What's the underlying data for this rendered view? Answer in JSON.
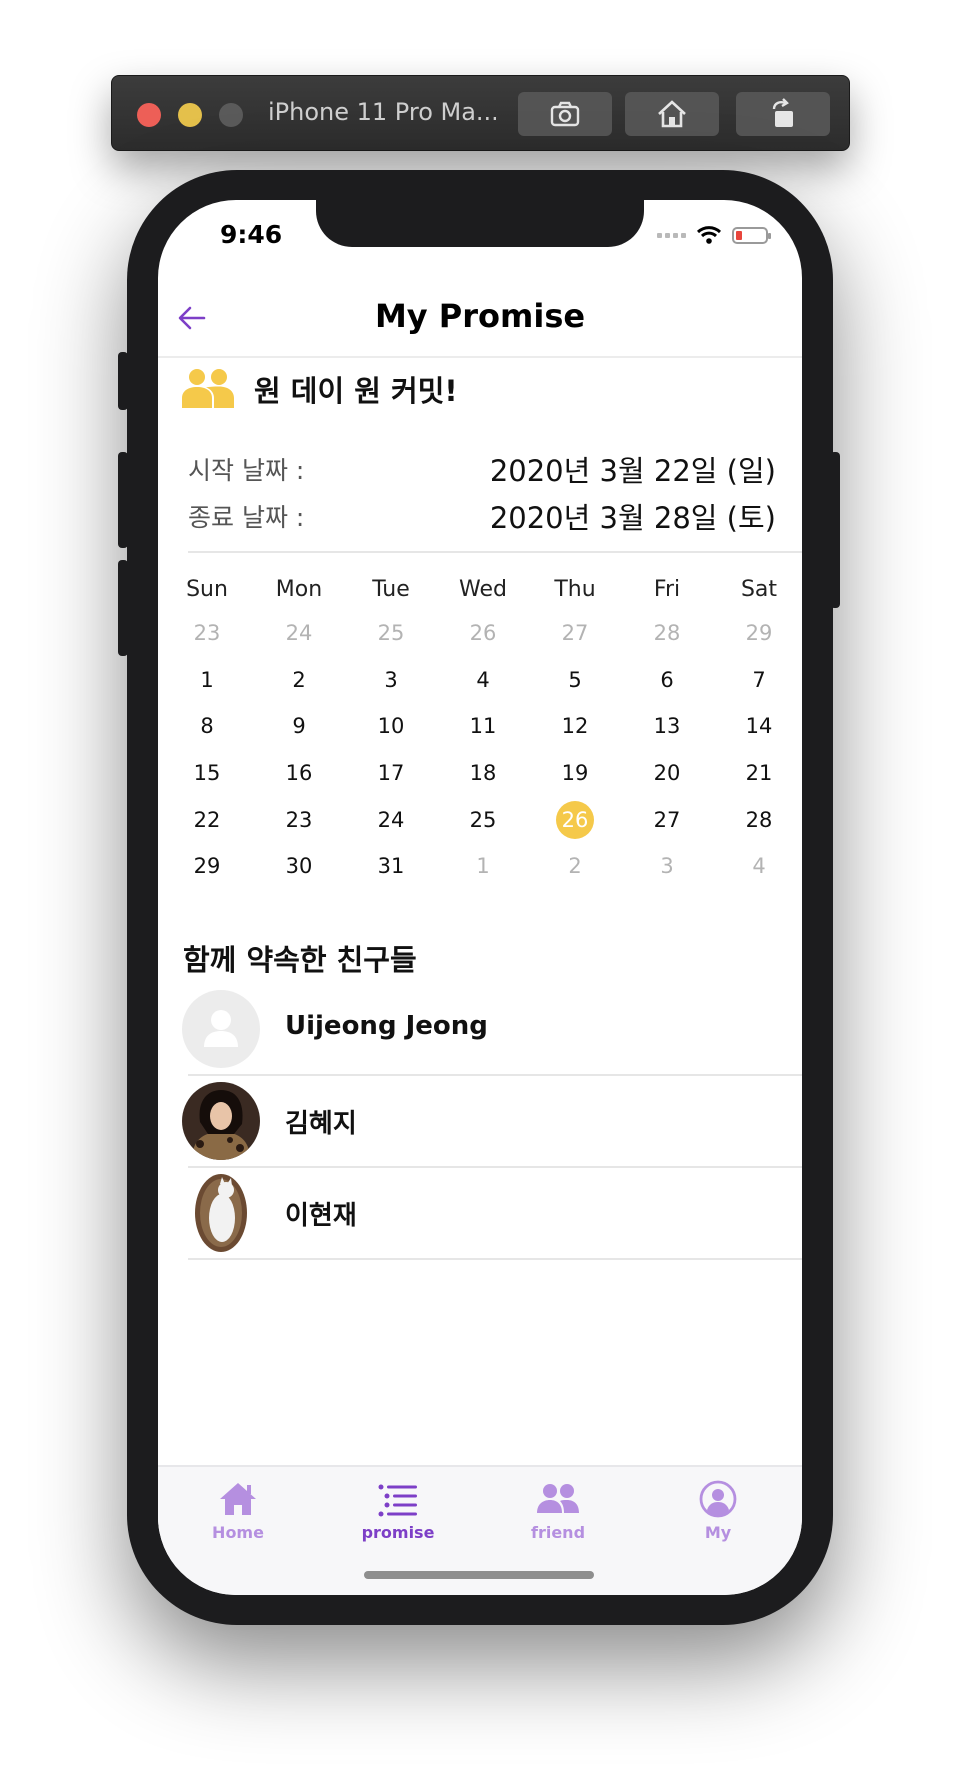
{
  "simulator": {
    "title": "iPhone 11 Pro Ma..."
  },
  "status_bar": {
    "time": "9:46"
  },
  "header": {
    "title": "My Promise"
  },
  "promise": {
    "title": "원 데이 원 커밋!",
    "start_label": "시작 날짜 :",
    "start_value": "2020년 3월 22일 (일)",
    "end_label": "종료 날짜 :",
    "end_value": "2020년 3월 28일 (토)"
  },
  "calendar": {
    "weekdays": [
      "Sun",
      "Mon",
      "Tue",
      "Wed",
      "Thu",
      "Fri",
      "Sat"
    ],
    "weeks": [
      [
        {
          "d": "23",
          "m": true
        },
        {
          "d": "24",
          "m": true
        },
        {
          "d": "25",
          "m": true
        },
        {
          "d": "26",
          "m": true
        },
        {
          "d": "27",
          "m": true
        },
        {
          "d": "28",
          "m": true
        },
        {
          "d": "29",
          "m": true
        }
      ],
      [
        {
          "d": "1"
        },
        {
          "d": "2"
        },
        {
          "d": "3"
        },
        {
          "d": "4"
        },
        {
          "d": "5"
        },
        {
          "d": "6"
        },
        {
          "d": "7"
        }
      ],
      [
        {
          "d": "8"
        },
        {
          "d": "9"
        },
        {
          "d": "10"
        },
        {
          "d": "11"
        },
        {
          "d": "12"
        },
        {
          "d": "13"
        },
        {
          "d": "14"
        }
      ],
      [
        {
          "d": "15"
        },
        {
          "d": "16"
        },
        {
          "d": "17"
        },
        {
          "d": "18"
        },
        {
          "d": "19"
        },
        {
          "d": "20"
        },
        {
          "d": "21"
        }
      ],
      [
        {
          "d": "22"
        },
        {
          "d": "23"
        },
        {
          "d": "24"
        },
        {
          "d": "25"
        },
        {
          "d": "26",
          "today": true
        },
        {
          "d": "27"
        },
        {
          "d": "28"
        }
      ],
      [
        {
          "d": "29"
        },
        {
          "d": "30"
        },
        {
          "d": "31"
        },
        {
          "d": "1",
          "m": true
        },
        {
          "d": "2",
          "m": true
        },
        {
          "d": "3",
          "m": true
        },
        {
          "d": "4",
          "m": true
        }
      ]
    ],
    "today_color": "#f5c94a"
  },
  "friends": {
    "title": "함께 약속한 친구들",
    "items": [
      {
        "name": "Uijeong Jeong",
        "avatar": "placeholder-avatar-icon"
      },
      {
        "name": "김혜지",
        "avatar": "photo-avatar"
      },
      {
        "name": "이현재",
        "avatar": "cat-photo-avatar"
      }
    ]
  },
  "tabs": [
    {
      "label": "Home",
      "icon": "home-icon",
      "active": false
    },
    {
      "label": "promise",
      "icon": "list-icon",
      "active": true
    },
    {
      "label": "friend",
      "icon": "people-icon",
      "active": false
    },
    {
      "label": "My",
      "icon": "profile-icon",
      "active": false
    }
  ],
  "colors": {
    "accent": "#7d3fc7",
    "accent_light": "#b58fe0",
    "highlight": "#f5c94a"
  }
}
